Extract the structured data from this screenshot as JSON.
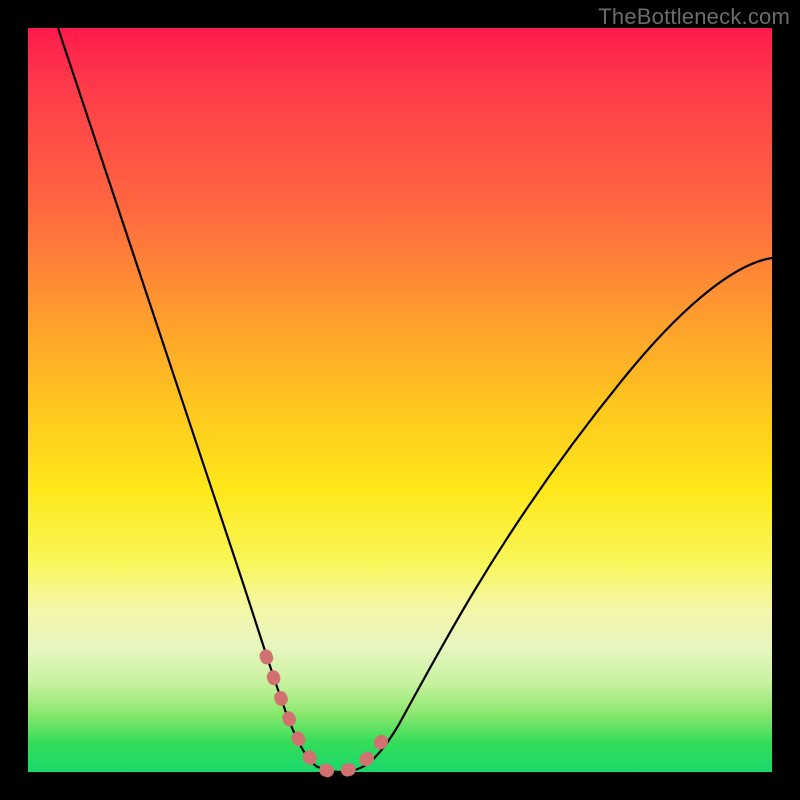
{
  "watermark": "TheBottleneck.com",
  "chart_data": {
    "type": "line",
    "title": "",
    "xlabel": "",
    "ylabel": "",
    "xlim": [
      0,
      100
    ],
    "ylim": [
      0,
      100
    ],
    "grid": false,
    "series": [
      {
        "name": "bottleneck-curve",
        "x": [
          4,
          8,
          12,
          16,
          20,
          24,
          28,
          31,
          33,
          35,
          37,
          39,
          41,
          43,
          45,
          47,
          50,
          55,
          60,
          66,
          74,
          84,
          95,
          100
        ],
        "y": [
          100,
          88,
          76,
          65,
          54,
          43,
          32,
          22,
          14,
          8,
          4,
          1,
          0,
          0,
          1,
          4,
          9,
          18,
          27,
          36,
          46,
          56,
          65,
          69
        ]
      },
      {
        "name": "highlight-segment",
        "x": [
          31,
          33,
          35,
          37,
          39,
          41,
          43,
          45,
          47
        ],
        "y": [
          22,
          14,
          8,
          4,
          1,
          0,
          0,
          1,
          4
        ]
      }
    ],
    "colors": {
      "curve": "#000000",
      "highlight": "#d27171"
    }
  }
}
